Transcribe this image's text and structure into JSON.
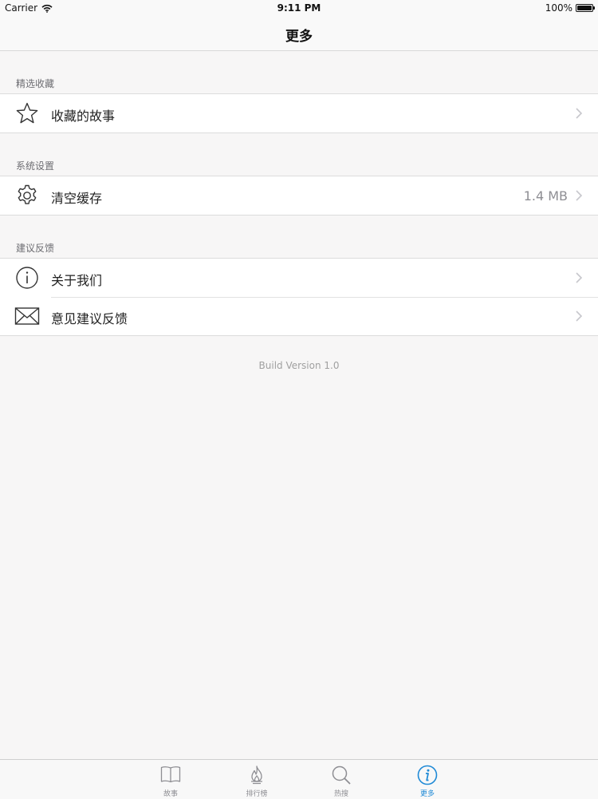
{
  "status_bar": {
    "carrier": "Carrier",
    "time": "9:11 PM",
    "battery": "100%",
    "icons": [
      "wifi-icon",
      "battery-icon"
    ]
  },
  "nav": {
    "title": "更多"
  },
  "sections": [
    {
      "header": "精选收藏",
      "items": [
        {
          "label": "收藏的故事",
          "icon": "star-icon",
          "detail": ""
        }
      ]
    },
    {
      "header": "系统设置",
      "items": [
        {
          "label": "清空缓存",
          "icon": "gear-icon",
          "detail": "1.4 MB"
        }
      ]
    },
    {
      "header": "建议反馈",
      "items": [
        {
          "label": "关于我们",
          "icon": "info-icon",
          "detail": ""
        },
        {
          "label": "意见建议反馈",
          "icon": "envelope-icon",
          "detail": ""
        }
      ]
    }
  ],
  "footer": {
    "build_version": "Build Version 1.0"
  },
  "tabs": [
    {
      "label": "故事",
      "icon": "book-icon",
      "active": false
    },
    {
      "label": "排行榜",
      "icon": "flame-icon",
      "active": false
    },
    {
      "label": "热搜",
      "icon": "search-icon",
      "active": false
    },
    {
      "label": "更多",
      "icon": "info-icon",
      "active": true
    }
  ],
  "colors": {
    "background": "#f7f6f6",
    "cell_background": "#ffffff",
    "separator": "#dcdcdc",
    "section_header_text": "#6d6d72",
    "detail_text": "#8e8e93",
    "tab_inactive": "#8e8e93",
    "tab_active": "#1f8ad6"
  }
}
